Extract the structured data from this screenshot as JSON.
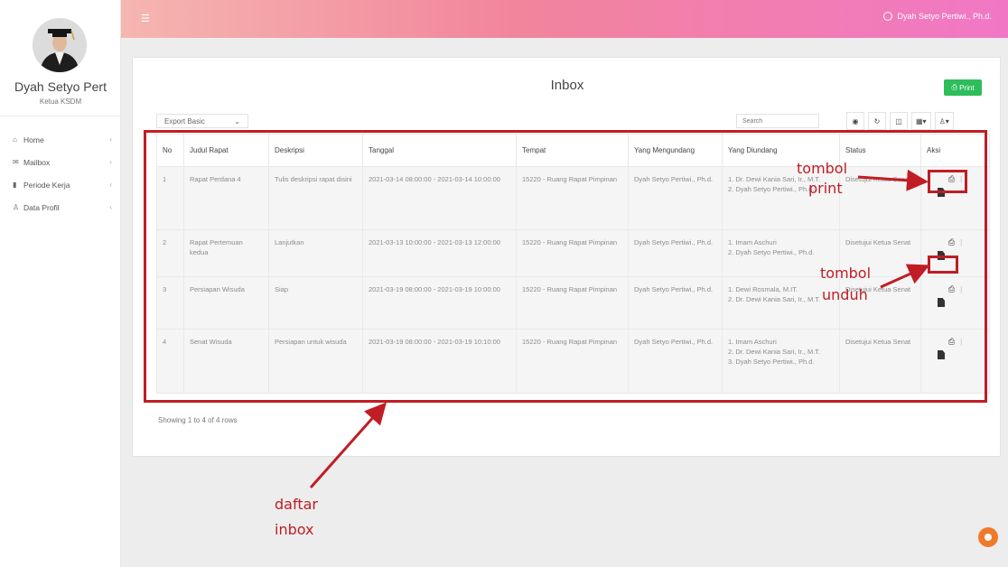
{
  "sidebar": {
    "user_name": "Dyah Setyo Pert",
    "user_role": "Ketua KSDM",
    "items": [
      {
        "icon": "home-icon",
        "label": "Home"
      },
      {
        "icon": "envelope-icon",
        "label": "Mailbox"
      },
      {
        "icon": "bar-chart-icon",
        "label": "Periode Kerja"
      },
      {
        "icon": "user-icon",
        "label": "Data Profil"
      }
    ]
  },
  "header": {
    "menu_icon": "hamburger-icon",
    "user_label": "Dyah Setyo Pertiwi., Ph.d."
  },
  "main": {
    "title": "Inbox",
    "print_label": "Print",
    "export_label": "Export Basic",
    "search_placeholder": "Search",
    "table": {
      "columns": [
        "No",
        "Judul Rapat",
        "Deskripsi",
        "Tanggal",
        "Tempat",
        "Yang Mengundang",
        "Yang Diundang",
        "Status",
        "Aksi"
      ],
      "rows": [
        {
          "no": "1",
          "judul": "Rapat Perdana 4",
          "deskripsi": "Tulis deskripsi rapat disini",
          "tanggal": "2021-03-14 08:00:00 - 2021-03-14 10:00:00",
          "tempat": "15220 - Ruang Rapat Pimpinan",
          "mengundang": "Dyah Setyo Pertiwi., Ph.d.",
          "diundang": [
            "1. Dr. Dewi Kania Sari, Ir., M.T.",
            "2. Dyah Setyo Pertiwi., Ph.d."
          ],
          "status": "Disetujui Ketua Senat"
        },
        {
          "no": "2",
          "judul": "Rapat Pertemuan kedua",
          "deskripsi": "Lanjutkan",
          "tanggal": "2021-03-13 10:00:00 - 2021-03-13 12:00:00",
          "tempat": "15220 - Ruang Rapat Pimpinan",
          "mengundang": "Dyah Setyo Pertiwi., Ph.d.",
          "diundang": [
            "1. Imam Aschuri",
            "2. Dyah Setyo Pertiwi., Ph.d."
          ],
          "status": "Disetujui Ketua Senat"
        },
        {
          "no": "3",
          "judul": "Persiapan Wisuda",
          "deskripsi": "Siap",
          "tanggal": "2021-03-19 08:00:00 - 2021-03-19 10:00:00",
          "tempat": "15220 - Ruang Rapat Pimpinan",
          "mengundang": "Dyah Setyo Pertiwi., Ph.d.",
          "diundang": [
            "1. Dewi Rosmala, M.IT.",
            "2. Dr. Dewi Kania Sari, Ir., M.T."
          ],
          "status": "Disetujui Ketua Senat"
        },
        {
          "no": "4",
          "judul": "Senat Wisuda",
          "deskripsi": "Persiapan untuk wisuda",
          "tanggal": "2021-03-19 08:00:00 - 2021-03-19 10:10:00",
          "tempat": "15220 - Ruang Rapat Pimpinan",
          "mengundang": "Dyah Setyo Pertiwi., Ph.d.",
          "diundang": [
            "1. Imam Aschuri",
            "2. Dr. Dewi Kania Sari, Ir., M.T.",
            "3. Dyah Setyo Pertiwi., Ph.d."
          ],
          "status": "Disetujui Ketua Senat"
        }
      ]
    },
    "footer_text": "Showing 1 to 4 of 4 rows"
  },
  "annotations": {
    "print_label": [
      "tombol",
      "print"
    ],
    "download_label": [
      "tombol",
      "unduh"
    ],
    "inbox_label": [
      "daftar",
      "inbox"
    ],
    "color": "#c01d25"
  },
  "colors": {
    "topbar_gradient": [
      "#f5b6b0",
      "#f2849c",
      "#f177c5"
    ],
    "print_button": "#2dbd5b",
    "fab": "#f07a2a"
  }
}
